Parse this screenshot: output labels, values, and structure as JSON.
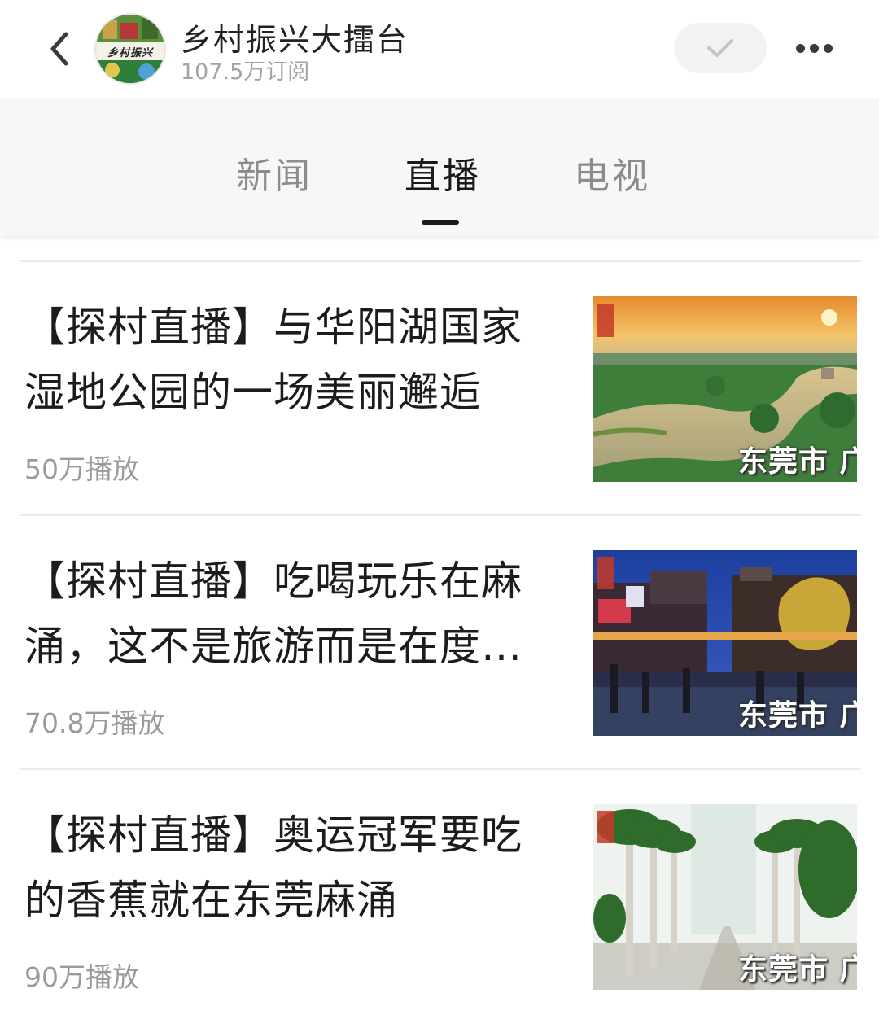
{
  "header": {
    "account_name": "乡村振兴大擂台",
    "subscribers": "107.5万订阅",
    "avatar_text": "乡村振兴"
  },
  "tabs": [
    {
      "label": "新闻",
      "active": false
    },
    {
      "label": "直播",
      "active": true
    },
    {
      "label": "电视",
      "active": false
    }
  ],
  "items": [
    {
      "title": "【探村直播】与华阳湖国家湿地公园的一场美丽邂逅",
      "views": "50万播放",
      "thumb_caption": "东莞市 广",
      "thumb_icon": "lake-wetland-sunset-photo"
    },
    {
      "title": "【探村直播】吃喝玩乐在麻涌，这不是旅游而是在度…",
      "views": "70.8万播放",
      "thumb_caption": "东莞市 广",
      "thumb_icon": "night-street-market-photo"
    },
    {
      "title": "【探村直播】奥运冠军要吃的香蕉就在东莞麻涌",
      "views": "90万播放",
      "thumb_caption": "东莞市 广",
      "thumb_icon": "palm-tree-avenue-photo"
    }
  ],
  "colors": {
    "tab_active": "#1a1a1a",
    "tab_inactive": "#8c8c8c",
    "meta_text": "#9a9a9a",
    "follow_bg": "#f2f2f2"
  }
}
